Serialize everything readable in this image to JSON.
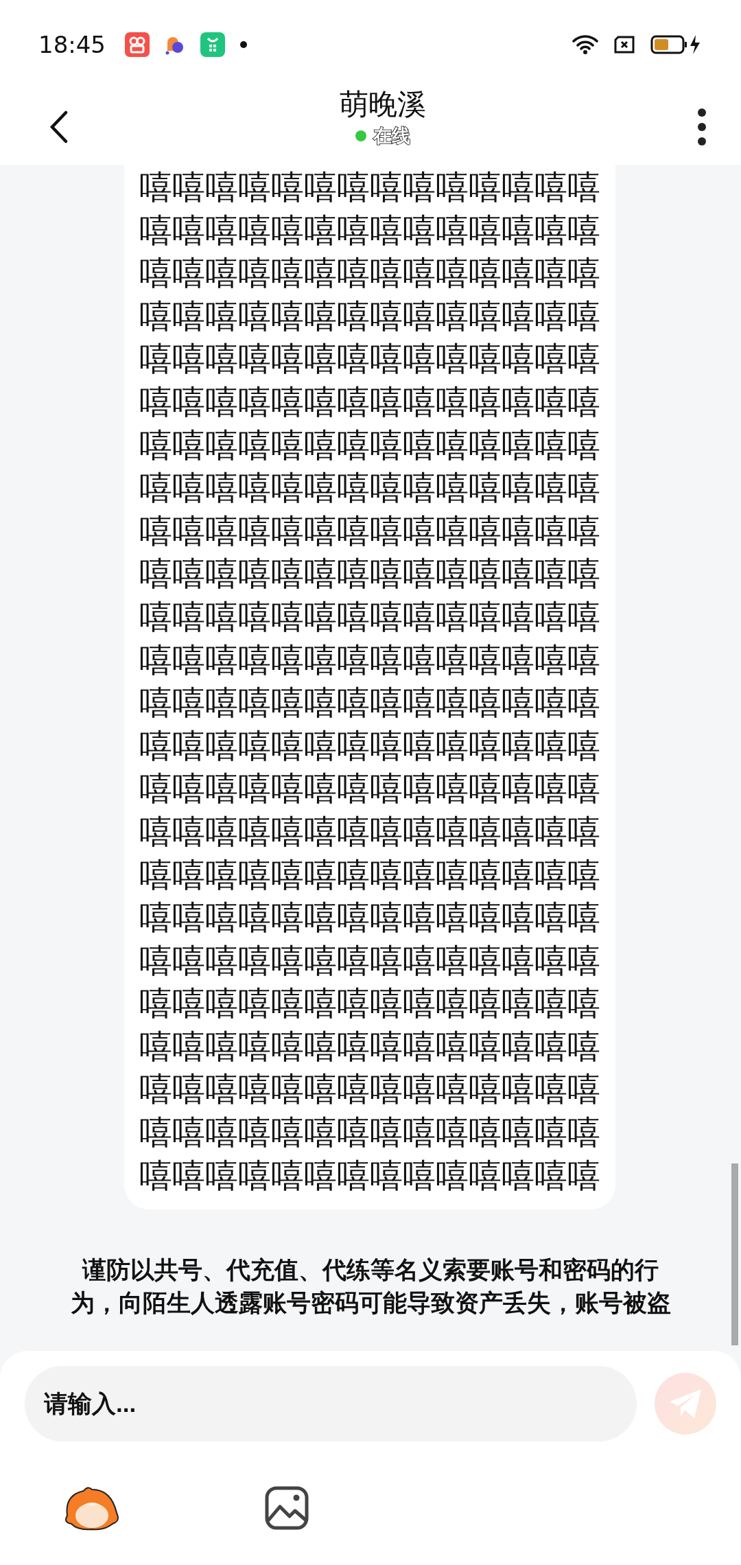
{
  "status_bar": {
    "time": "18:45"
  },
  "header": {
    "title": "萌晚溪",
    "status": "在线",
    "online": true
  },
  "message": {
    "lines": [
      "嘻嘻嘻嘻嘻嘻嘻嘻嘻嘻嘻嘻嘻嘻",
      "嘻嘻嘻嘻嘻嘻嘻嘻嘻嘻嘻嘻嘻嘻",
      "嘻嘻嘻嘻嘻嘻嘻嘻嘻嘻嘻嘻嘻嘻",
      "嘻嘻嘻嘻嘻嘻嘻嘻嘻嘻嘻嘻嘻嘻",
      "嘻嘻嘻嘻嘻嘻嘻嘻嘻嘻嘻嘻嘻嘻",
      "嘻嘻嘻嘻嘻嘻嘻嘻嘻嘻嘻嘻嘻嘻",
      "嘻嘻嘻嘻嘻嘻嘻嘻嘻嘻嘻嘻嘻嘻",
      "嘻嘻嘻嘻嘻嘻嘻嘻嘻嘻嘻嘻嘻嘻",
      "嘻嘻嘻嘻嘻嘻嘻嘻嘻嘻嘻嘻嘻嘻",
      "嘻嘻嘻嘻嘻嘻嘻嘻嘻嘻嘻嘻嘻嘻",
      "嘻嘻嘻嘻嘻嘻嘻嘻嘻嘻嘻嘻嘻嘻",
      "嘻嘻嘻嘻嘻嘻嘻嘻嘻嘻嘻嘻嘻嘻",
      "嘻嘻嘻嘻嘻嘻嘻嘻嘻嘻嘻嘻嘻嘻",
      "嘻嘻嘻嘻嘻嘻嘻嘻嘻嘻嘻嘻嘻嘻",
      "嘻嘻嘻嘻嘻嘻嘻嘻嘻嘻嘻嘻嘻嘻",
      "嘻嘻嘻嘻嘻嘻嘻嘻嘻嘻嘻嘻嘻嘻",
      "嘻嘻嘻嘻嘻嘻嘻嘻嘻嘻嘻嘻嘻嘻",
      "嘻嘻嘻嘻嘻嘻嘻嘻嘻嘻嘻嘻嘻嘻",
      "嘻嘻嘻嘻嘻嘻嘻嘻嘻嘻嘻嘻嘻嘻",
      "嘻嘻嘻嘻嘻嘻嘻嘻嘻嘻嘻嘻嘻嘻",
      "嘻嘻嘻嘻嘻嘻嘻嘻嘻嘻嘻嘻嘻嘻",
      "嘻嘻嘻嘻嘻嘻嘻嘻嘻嘻嘻嘻嘻嘻",
      "嘻嘻嘻嘻嘻嘻嘻嘻嘻嘻嘻嘻嘻嘻",
      "嘻嘻嘻嘻嘻嘻嘻嘻嘻嘻嘻嘻嘻嘻"
    ]
  },
  "notice": "谨防以共号、代充值、代练等名义索要账号和密码的行为，向陌生人透露账号密码可能导致资产丢失，账号被盗",
  "input": {
    "placeholder": "请输入..."
  }
}
